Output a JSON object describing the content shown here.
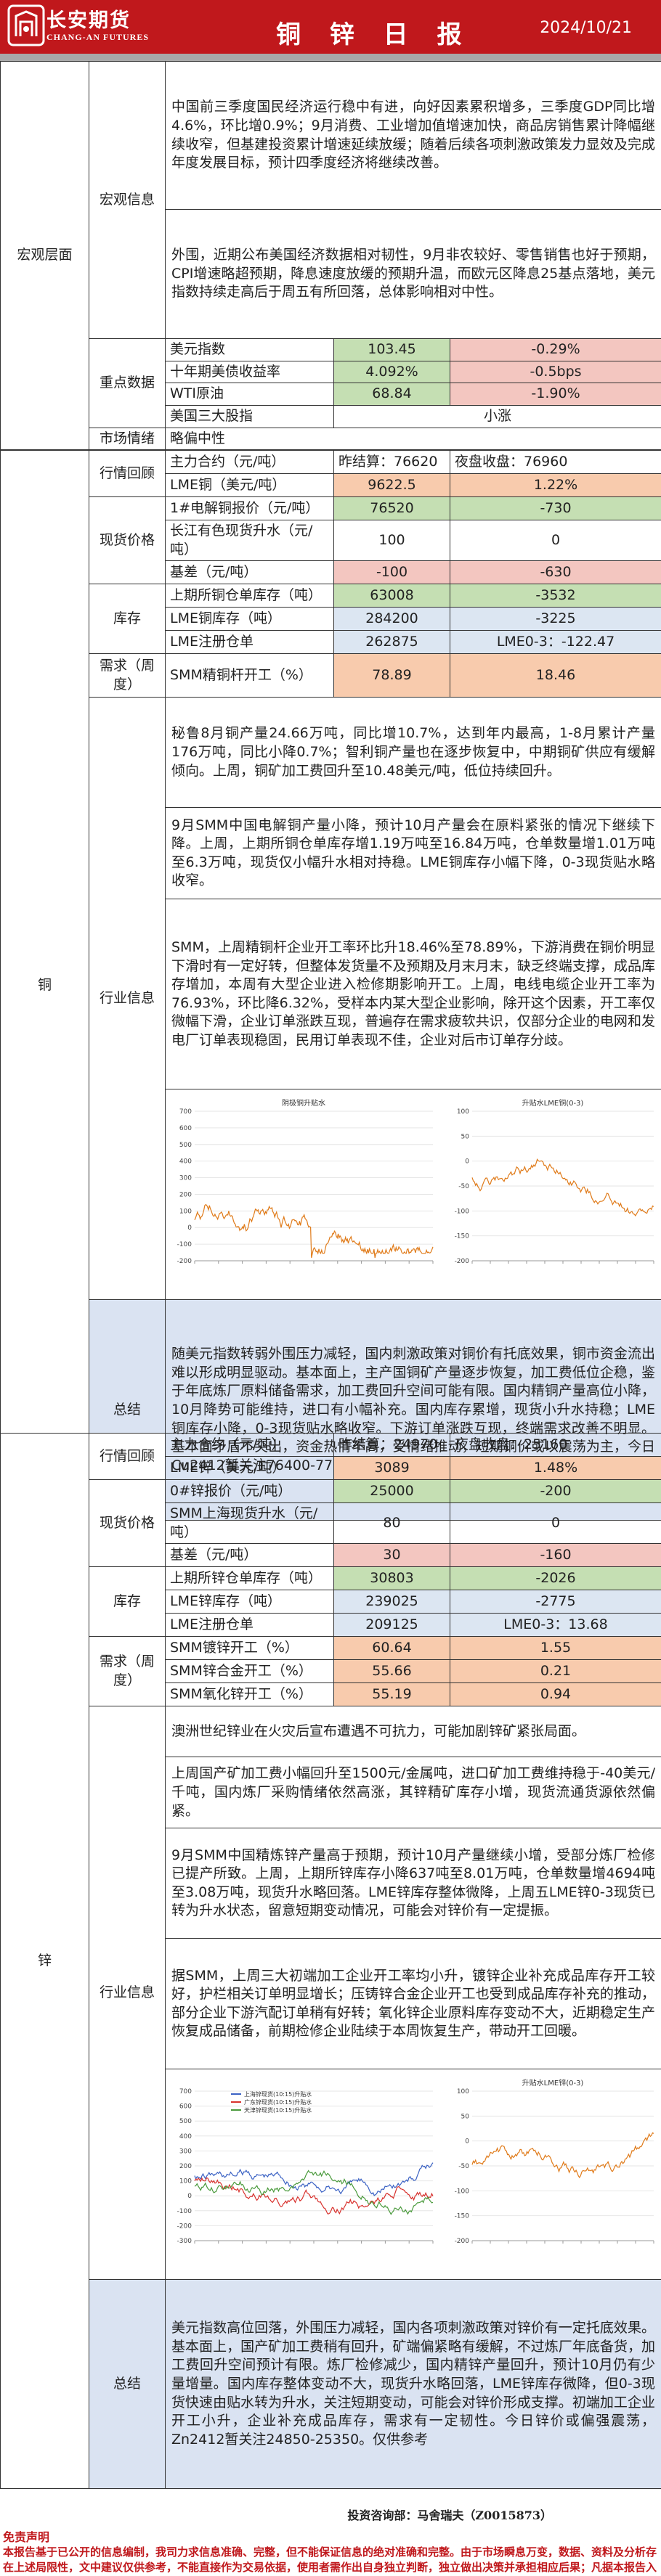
{
  "header": {
    "company_cn": "长安期货",
    "company_en": "CHANG-AN FUTURES",
    "title": "铜 锌 日 报",
    "date": "2024/10/21"
  },
  "macro": {
    "section": "宏观层面",
    "info_label": "宏观信息",
    "para1": "中国前三季度国民经济运行稳中有进，向好因素累积增多，三季度GDP同比增4.6%，环比增0.9%；9月消费、工业增加值增速加快，商品房销售累计降幅继续收窄，但基建投资累计增速延续放缓；随着后续各项刺激政策发力显效及完成年度发展目标，预计四季度经济将继续改善。",
    "para2": "外围，近期公布美国经济数据相对韧性，9月非农较好、零售销售也好于预期，CPI增速略超预期，降息速度放缓的预期升温，而欧元区降息25基点落地，美元指数持续走高后于周五有所回落，总体影响相对中性。",
    "key_label": "重点数据",
    "rows": [
      {
        "name": "美元指数",
        "v1": "103.45",
        "v2": "-0.29%"
      },
      {
        "name": "十年期美债收益率",
        "v1": "4.092%",
        "v2": "-0.5bps"
      },
      {
        "name": "WTI原油",
        "v1": "68.84",
        "v2": "-1.90%"
      },
      {
        "name": "美国三大股指",
        "v1": "小涨",
        "v2": ""
      }
    ],
    "sentiment_label": "市场情绪",
    "sentiment": "略偏中性"
  },
  "copper": {
    "section": "铜",
    "review_label": "行情回顾",
    "contract": "主力合约（元/吨）",
    "close_label": "昨结算：76620",
    "night_label": "夜盘收盘：76960",
    "lme_name": "LME铜（美元/吨）",
    "lme_v1": "9622.5",
    "lme_v2": "1.22%",
    "spot_label": "现货价格",
    "spot_rows": [
      {
        "name": "1#电解铜报价（元/吨）",
        "v1": "76520",
        "v2": "-730"
      },
      {
        "name": "长江有色现货升水（元/吨）",
        "v1": "100",
        "v2": "0"
      },
      {
        "name": "基差（元/吨）",
        "v1": "-100",
        "v2": "-630"
      }
    ],
    "stock_label": "库存",
    "stock_rows": [
      {
        "name": "上期所铜仓单库存（吨）",
        "v1": "63008",
        "v2": "-3532"
      },
      {
        "name": "LME铜库存（吨）",
        "v1": "284200",
        "v2": "-3225"
      },
      {
        "name": "LME注册仓单",
        "v1": "262875",
        "v2": "LME0-3：-122.47"
      }
    ],
    "demand_label": "需求（周度）",
    "demand_rows": [
      {
        "name": "SMM精铜杆开工（%）",
        "v1": "78.89",
        "v2": "18.46"
      }
    ],
    "industry_label": "行业信息",
    "industry_paras": [
      "秘鲁8月铜产量24.66万吨，同比增10.7%，达到年内最高，1-8月累计产量176万吨，同比小降0.7%；智利铜产量也在逐步恢复中，中期铜矿供应有缓解倾向。上周，铜矿加工费回升至10.48美元/吨，低位持续回升。",
      "9月SMM中国电解铜产量小降，预计10月产量会在原料紧张的情况下继续下降。上周，上期所铜仓单库存增1.19万吨至16.84万吨，仓单数量增1.01万吨至6.3万吨，现货仅小幅升水相对持稳。LME铜库存小幅下降，0-3现货贴水略收窄。",
      "SMM，上周精铜杆企业开工率环比升18.46%至78.89%，下游消费在铜价明显下滑时有一定好转，但整体发货量不及预期及月末月末，缺乏终端支撑，成品库存增加，本周有大型企业进入检修期影响开工。上周，电线电缆企业开工率为76.93%，环比降6.32%，受样本内某大型企业影响，除开这个因素，开工率仅微幅下滑，企业订单涨跌互现，普遍存在需求疲软共识，仅部分企业的电网和发电厂订单表现稳固，民用订单表现不佳，企业对后市订单存分歧。"
    ],
    "summary_label": "总结",
    "summary": "随美元指数转弱外围压力减轻，国内刺激政策对铜价有托底效果，铜市资金流出难以形成明显驱动。基本面上，主产国铜矿产量逐步恢复，加工费低位企稳，鉴于年底炼厂原料储备需求，加工费回升空间可能有限。国内精铜产量高位小降，10月降势可能维持，进口有小幅补充。国内库存累增，现货小升水持稳；LME铜库存小降，0-3现货贴水略收窄。下游订单涨跌互现，终端需求改善不明显。基本面矛盾不突出，资金热情不高，受情绪推动，短期铜价或以震荡为主，今日Cu2412暂关注76400-77800。",
    "chart1": {
      "title": "阴极铜升贴水",
      "yticks": [
        "700",
        "600",
        "500",
        "400",
        "300",
        "200",
        "100",
        "0",
        "-100",
        "-200"
      ]
    },
    "chart2": {
      "title": "升贴水LME铜(0-3)",
      "yticks": [
        "100",
        "50",
        "0",
        "-50",
        "-100",
        "-150",
        "-200"
      ]
    }
  },
  "zinc": {
    "section": "锌",
    "review_label": "行情回顾",
    "contract": "主力合约（元/吨）",
    "close_label": "昨结算：24970",
    "night_label": "夜盘收盘：25160",
    "lme_name": "LME锌（美元/吨）",
    "lme_v1": "3089",
    "lme_v2": "1.48%",
    "spot_label": "现货价格",
    "spot_rows": [
      {
        "name": "0#锌报价（元/吨）",
        "v1": "25000",
        "v2": "-200"
      },
      {
        "name": "SMM上海现货升水（元/吨）",
        "v1": "80",
        "v2": "0"
      },
      {
        "name": "基差（元/吨）",
        "v1": "30",
        "v2": "-160"
      }
    ],
    "stock_label": "库存",
    "stock_rows": [
      {
        "name": "上期所锌仓单库存（吨）",
        "v1": "30803",
        "v2": "-2026"
      },
      {
        "name": "LME锌库存（吨）",
        "v1": "239025",
        "v2": "-2775"
      },
      {
        "name": "LME注册仓单",
        "v1": "209125",
        "v2": "LME0-3：13.68"
      }
    ],
    "demand_label": "需求（周度）",
    "demand_rows": [
      {
        "name": "SMM镀锌开工（%）",
        "v1": "60.64",
        "v2": "1.55"
      },
      {
        "name": "SMM锌合金开工（%）",
        "v1": "55.66",
        "v2": "0.21"
      },
      {
        "name": "SMM氧化锌开工（%）",
        "v1": "55.19",
        "v2": "0.94"
      }
    ],
    "industry_label": "行业信息",
    "industry_paras": [
      "澳洲世纪锌业在火灾后宣布遭遇不可抗力，可能加剧锌矿紧张局面。",
      "上周国产矿加工费小幅回升至1500元/金属吨，进口矿加工费维持稳于-40美元/千吨，国内炼厂采购情绪依然高涨，其锌精矿库存小增，现货流通货源依然偏紧。",
      "9月SMM中国精炼锌产量高于预期，预计10月产量继续小增，受部分炼厂检修已提产所致。上周，上期所锌库存小降637吨至8.01万吨，仓单数量增4694吨至3.08万吨，现货升水略回落。LME锌库存整体微降，上周五LME锌0-3现货已转为升水状态，留意短期变动情况，可能会对锌价有一定提振。",
      "据SMM，上周三大初端加工企业开工率均小升，镀锌企业补充成品库存开工较好，护栏相关订单明显增长；压铸锌合金企业开工也受到成品库存补充的推动，部分企业下游汽配订单稍有好转；氧化锌企业原料库存变动不大，近期稳定生产恢复成品储备，前期检修企业陆续于本周恢复生产，带动开工回暖。"
    ],
    "summary_label": "总结",
    "summary": "美元指数高位回落，外围压力减轻，国内各项刺激政策对锌价有一定托底效果。基本面上，国产矿加工费稍有回升，矿端偏紧略有缓解，不过炼厂年底备货，加工费回升空间预计有限。炼厂检修减少，国内精锌产量回升，预计10月仍有少量增量。国内库存整体变动不大，现货升水略回落，LME锌库存微降，但0-3现货快速由贴水转为升水，关注短期变动，可能会对锌价形成支撑。初端加工企业开工小升，企业补充成品库存，需求有一定韧性。今日锌价或偏强震荡，Zn2412暂关注24850-25350。仅供参考",
    "chart1": {
      "title": "",
      "legend": [
        "上海锌现货(10:15)升贴水",
        "广东锌现货(10:15)升贴水",
        "天津锌现货(10:15)升贴水"
      ],
      "yticks": [
        "700",
        "600",
        "500",
        "400",
        "300",
        "200",
        "100",
        "0",
        "-100",
        "-200",
        "-300"
      ]
    },
    "chart2": {
      "title": "升贴水LME锌(0-3)",
      "yticks": [
        "100",
        "50",
        "0",
        "-50",
        "-100",
        "-150",
        "-200"
      ]
    }
  },
  "footer": {
    "analyst": "投资咨询部：马舍瑞夫（Z0015873）",
    "disclaimer_title": "免责声明",
    "disclaimer": "本报告基于已公开的信息编制，我司力求信息准确、完整，但不能保证信息的绝对准确和完整。由于市场瞬息万变，数据、资料及分析存在上述局限性，文中建议仅供参考，不能直接作为交易依据，使用者需作出自身独立判断，独立做出决策并承担相应后果；凡据本报告入市者，本公司及作者均不承担由此引发的任何损失。"
  },
  "colors": {
    "brand_red": "#c0181c",
    "positive_green": "#c5dfb3",
    "negative_pink": "#f3c6c0",
    "summary_blue": "#dae3f2",
    "chart_orange": "#e07b1a"
  }
}
